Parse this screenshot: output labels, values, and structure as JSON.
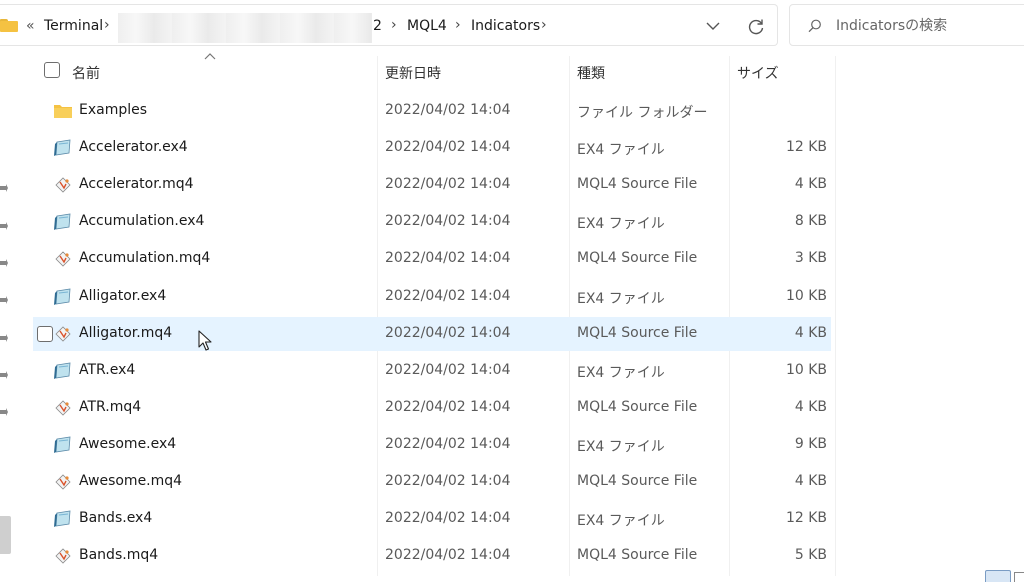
{
  "address_bar": {
    "overflow_label": "«",
    "crumbs": [
      "Terminal",
      "2",
      "MQL4",
      "Indicators"
    ],
    "separator": "›"
  },
  "search": {
    "placeholder": "Indicatorsの検索"
  },
  "columns": {
    "name": "名前",
    "date": "更新日時",
    "type": "種類",
    "size": "サイズ"
  },
  "rows": [
    {
      "name": "Examples",
      "date": "2022/04/02 14:04",
      "type": "ファイル フォルダー",
      "size": "",
      "icon": "folder-icon"
    },
    {
      "name": "Accelerator.ex4",
      "date": "2022/04/02 14:04",
      "type": "EX4 ファイル",
      "size": "12 KB",
      "icon": "ex4-file-icon"
    },
    {
      "name": "Accelerator.mq4",
      "date": "2022/04/02 14:04",
      "type": "MQL4 Source File",
      "size": "4 KB",
      "icon": "mq4-file-icon"
    },
    {
      "name": "Accumulation.ex4",
      "date": "2022/04/02 14:04",
      "type": "EX4 ファイル",
      "size": "8 KB",
      "icon": "ex4-file-icon"
    },
    {
      "name": "Accumulation.mq4",
      "date": "2022/04/02 14:04",
      "type": "MQL4 Source File",
      "size": "3 KB",
      "icon": "mq4-file-icon"
    },
    {
      "name": "Alligator.ex4",
      "date": "2022/04/02 14:04",
      "type": "EX4 ファイル",
      "size": "10 KB",
      "icon": "ex4-file-icon"
    },
    {
      "name": "Alligator.mq4",
      "date": "2022/04/02 14:04",
      "type": "MQL4 Source File",
      "size": "4 KB",
      "icon": "mq4-file-icon",
      "hover": true
    },
    {
      "name": "ATR.ex4",
      "date": "2022/04/02 14:04",
      "type": "EX4 ファイル",
      "size": "10 KB",
      "icon": "ex4-file-icon"
    },
    {
      "name": "ATR.mq4",
      "date": "2022/04/02 14:04",
      "type": "MQL4 Source File",
      "size": "4 KB",
      "icon": "mq4-file-icon"
    },
    {
      "name": "Awesome.ex4",
      "date": "2022/04/02 14:04",
      "type": "EX4 ファイル",
      "size": "9 KB",
      "icon": "ex4-file-icon"
    },
    {
      "name": "Awesome.mq4",
      "date": "2022/04/02 14:04",
      "type": "MQL4 Source File",
      "size": "4 KB",
      "icon": "mq4-file-icon"
    },
    {
      "name": "Bands.ex4",
      "date": "2022/04/02 14:04",
      "type": "EX4 ファイル",
      "size": "12 KB",
      "icon": "ex4-file-icon"
    },
    {
      "name": "Bands.mq4",
      "date": "2022/04/02 14:04",
      "type": "MQL4 Source File",
      "size": "5 KB",
      "icon": "mq4-file-icon"
    }
  ],
  "colors": {
    "hover_row": "#e5f3ff",
    "folder": "#f5c242"
  }
}
